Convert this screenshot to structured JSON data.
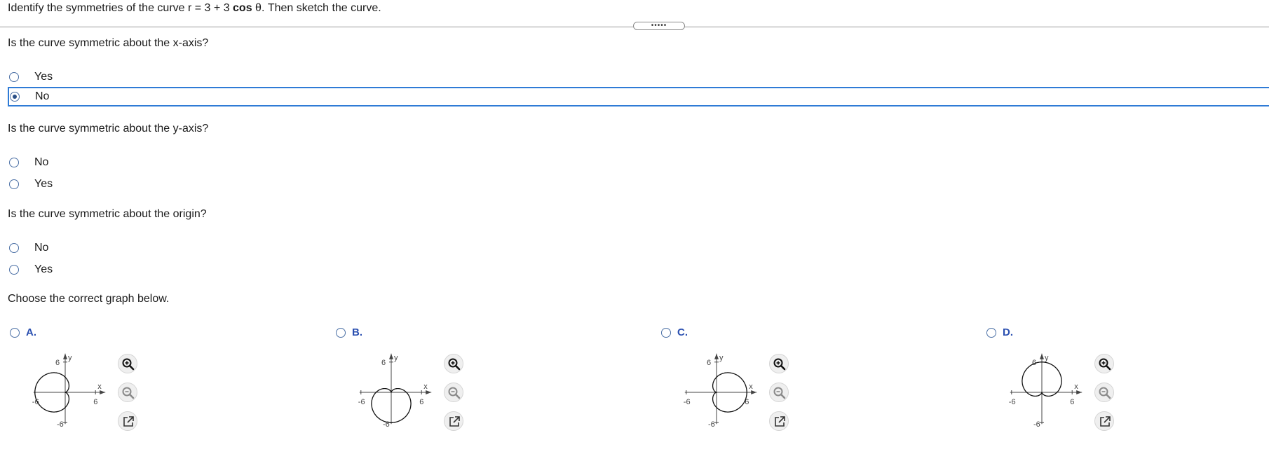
{
  "prompt": {
    "prefix": "Identify the symmetries of the curve r = 3 + 3 ",
    "bold": "cos",
    "suffix": " θ. Then sketch the curve."
  },
  "collapse_handle": "•••••",
  "q1": {
    "text": "Is the curve symmetric about the x-axis?",
    "options": [
      "Yes",
      "No"
    ],
    "selected": "No"
  },
  "q2": {
    "text": "Is the curve symmetric about the y-axis?",
    "options": [
      "No",
      "Yes"
    ]
  },
  "q3": {
    "text": "Is the curve symmetric about the origin?",
    "options": [
      "No",
      "Yes"
    ]
  },
  "q4": {
    "text": "Choose the correct graph below.",
    "choices": [
      {
        "letter": "A.",
        "orientation": "left",
        "ticks": {
          "y": "6",
          "x": "6",
          "negx": "-6",
          "negy": "-6"
        },
        "axis_x": "x",
        "axis_y": "y"
      },
      {
        "letter": "B.",
        "orientation": "down",
        "ticks": {
          "y": "6",
          "x": "6",
          "negx": "-6",
          "negy": "-6"
        },
        "axis_x": "x",
        "axis_y": "y"
      },
      {
        "letter": "C.",
        "orientation": "right",
        "ticks": {
          "y": "6",
          "x": "6",
          "negx": "-6",
          "negy": "-6"
        },
        "axis_x": "x",
        "axis_y": "y"
      },
      {
        "letter": "D.",
        "orientation": "up",
        "ticks": {
          "y": "6",
          "x": "6",
          "negx": "-6",
          "negy": "-6"
        },
        "axis_x": "x",
        "axis_y": "y"
      }
    ]
  },
  "colors": {
    "accent": "#2f7bd6",
    "choice_letter": "#2a4fb0"
  }
}
